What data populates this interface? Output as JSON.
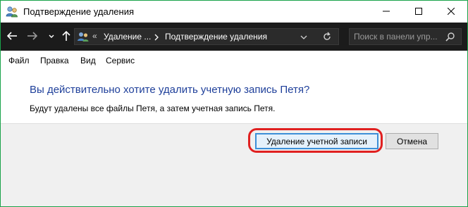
{
  "window": {
    "title": "Подтверждение удаления",
    "accent_border": "#1aa34a"
  },
  "navigation": {
    "breadcrumb_prefix": "«",
    "breadcrumb_1": "Удаление ...",
    "breadcrumb_2": "Подтверждение удаления",
    "search_placeholder": "Поиск в панели упр..."
  },
  "menu": {
    "items": [
      "Файл",
      "Правка",
      "Вид",
      "Сервис"
    ]
  },
  "dialog": {
    "question": "Вы действительно хотите удалить учетную запись Петя?",
    "description": "Будут удалены все файлы Петя, а затем учетная запись Петя.",
    "delete_button": "Удаление учетной записи",
    "cancel_button": "Отмена",
    "highlight_color": "#e02020",
    "question_color": "#1e3f9a"
  },
  "icons": {
    "title": "users-icon",
    "back": "arrow-left-icon",
    "forward": "arrow-right-icon",
    "recent": "chevron-down-icon",
    "up": "arrow-up-icon",
    "address": "users-icon",
    "refresh": "refresh-icon",
    "search": "search-icon",
    "minimize": "minimize-icon",
    "maximize": "maximize-icon",
    "close": "close-icon"
  }
}
